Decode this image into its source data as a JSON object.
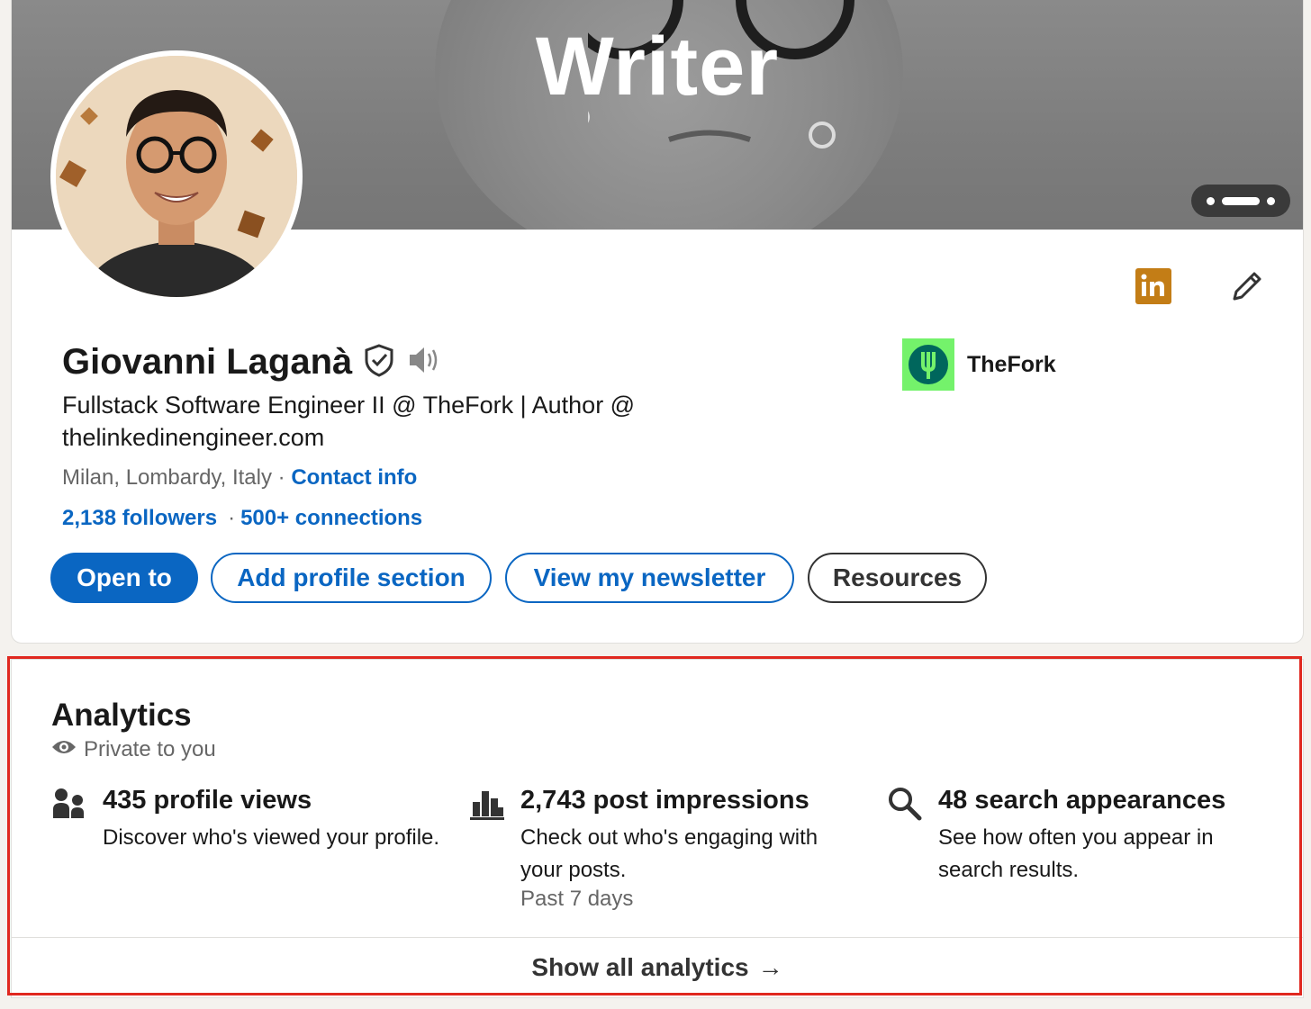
{
  "banner": {
    "text": "Writer"
  },
  "profile": {
    "name": "Giovanni Laganà",
    "headline": "Fullstack Software Engineer II @ TheFork | Author @ thelinkedinengineer.com",
    "location": "Milan, Lombardy, Italy",
    "location_sep": "·",
    "contact_label": "Contact info",
    "followers": "2,138 followers",
    "stats_sep": "·",
    "connections": "500+ connections"
  },
  "company": {
    "name": "TheFork"
  },
  "actions": {
    "open_to": "Open to",
    "add_section": "Add profile section",
    "newsletter": "View my newsletter",
    "resources": "Resources"
  },
  "analytics": {
    "title": "Analytics",
    "subtitle": "Private to you",
    "metrics": [
      {
        "title": "435 profile views",
        "description": "Discover who's viewed your profile.",
        "icon": "people-icon"
      },
      {
        "title": "2,743 post impressions",
        "description": "Check out who's engaging with your posts.",
        "note": "Past 7 days",
        "icon": "bar-chart-icon"
      },
      {
        "title": "48 search appearances",
        "description": "See how often you appear in search results.",
        "icon": "search-icon"
      }
    ],
    "show_all": "Show all analytics",
    "show_all_arrow": "→"
  },
  "colors": {
    "brand_blue": "#0a66c2",
    "highlight_red": "#e0281f",
    "company_green": "#74f26b",
    "linkedin_badge": "#c37d16"
  }
}
